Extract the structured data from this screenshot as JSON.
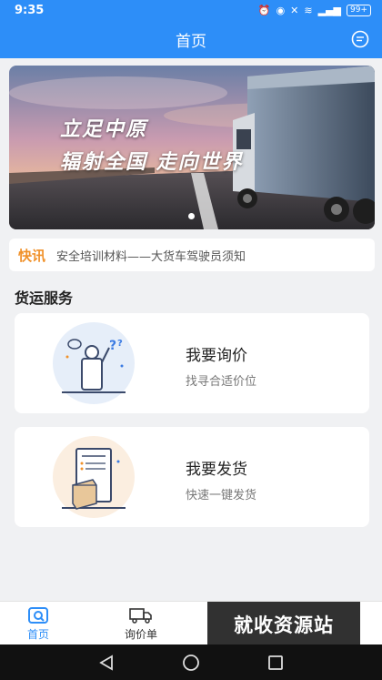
{
  "status_bar": {
    "time": "9:35",
    "battery": "99+"
  },
  "header": {
    "title": "首页"
  },
  "banner": {
    "line1": "立足中原",
    "line2": "辐射全国  走向世界"
  },
  "news": {
    "tag": "快讯",
    "text": "安全培训材料——大货车驾驶员须知"
  },
  "section": {
    "title": "货运服务"
  },
  "cards": [
    {
      "title": "我要询价",
      "subtitle": "找寻合适价位",
      "icon": "inquiry-person-icon"
    },
    {
      "title": "我要发货",
      "subtitle": "快速一键发货",
      "icon": "package-clipboard-icon"
    }
  ],
  "tabbar": {
    "items": [
      {
        "label": "首页",
        "icon": "home-icon",
        "active": true
      },
      {
        "label": "询价单",
        "icon": "truck-icon",
        "active": false
      }
    ]
  },
  "watermark": {
    "text": "就收资源站"
  },
  "colors": {
    "primary": "#2d8ef8",
    "accent": "#f0912a"
  }
}
